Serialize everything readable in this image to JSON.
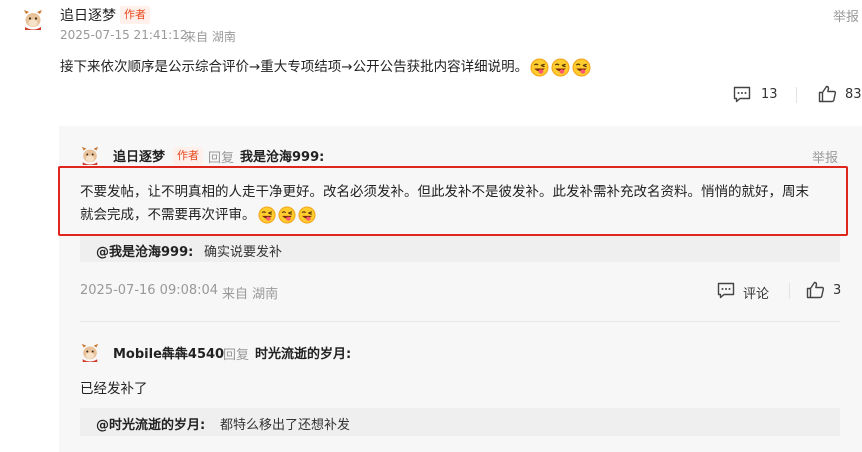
{
  "top_comment": {
    "author": "追日逐梦",
    "author_tag": "作者",
    "timestamp": "2025-07-15 21:41:12",
    "location": "来自 湖南",
    "report_label": "举报",
    "text": "接下来依次顺序是公示综合评价→重大专项结项→公开公告获批内容详细说明。",
    "emoji_icon": "tongue-wink-emoji",
    "comment_count": "13",
    "like_count": "83"
  },
  "reply_1": {
    "author": "追日逐梦",
    "author_tag": "作者",
    "reply_word": "回复",
    "reply_to": "我是沧海999:",
    "report_label": "举报",
    "text_line1": "不要发帖，让不明真相的人走干净更好。改名必须发补。但此发补不是彼发补。此发补需补充改名资料。悄悄的就好，周末",
    "text_line2": "就会完成，不需要再次评审。",
    "quote_at": "@我是沧海999:",
    "quote_text": "确实说要发补",
    "timestamp": "2025-07-16 09:08:04",
    "location": "来自 湖南",
    "comment_label": "评论",
    "like_count": "3"
  },
  "reply_2": {
    "author": "Mobile犇犇4540",
    "reply_word": "回复",
    "reply_to": "时光流逝的岁月:",
    "text": "已经发补了",
    "quote_at": "@时光流逝的岁月:",
    "quote_text": "都特么移出了还想补发"
  },
  "colors": {
    "accent_tag": "#e8491d",
    "highlight_border": "#e0251c",
    "meta_gray": "#999999"
  }
}
